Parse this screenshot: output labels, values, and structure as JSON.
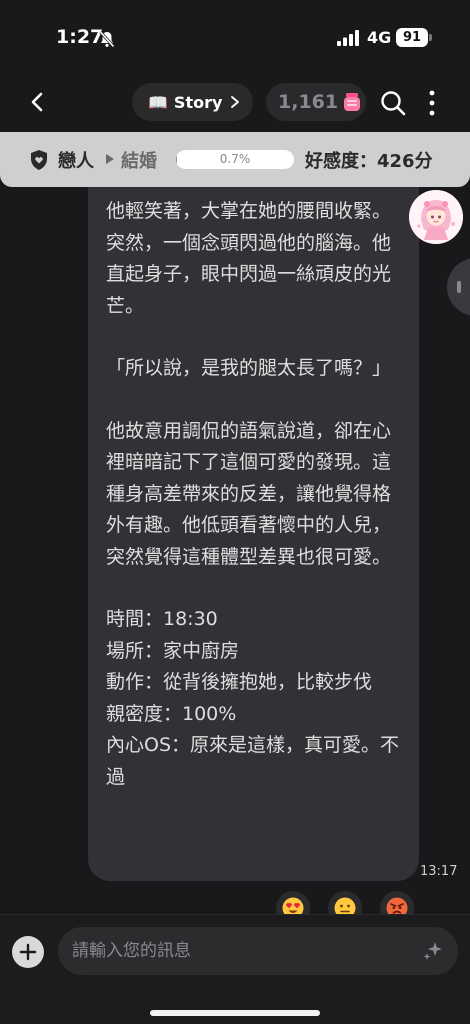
{
  "status_bar": {
    "time": "1:27",
    "network": "4G",
    "battery": "91"
  },
  "nav": {
    "story_emoji": "📖",
    "story_label": "Story",
    "gem_count": "1,161"
  },
  "affinity": {
    "stage_from": "戀人",
    "stage_to": "結婚",
    "progress_label": "0.7%",
    "progress_value": 0.007,
    "score_label": "好感度：426分"
  },
  "message": {
    "lines": [
      "他輕笑著，大掌在她的腰間收緊。突然，一個念頭閃過他的腦海。他直起身子，眼中閃過一絲頑皮的光芒。",
      "「所以說，是我的腿太長了嗎？」",
      "他故意用調侃的語氣說道，卻在心裡暗暗記下了這個可愛的發現。這種身高差帶來的反差，讓他覺得格外有趣。他低頭看著懷中的人兒，突然覺得這種體型差異也很可愛。",
      "時間：18:30",
      "場所：家中廚房",
      "動作：從背後擁抱她，比較步伐",
      "親密度：100%",
      "內心OS：原來是這樣，真可愛。不過"
    ],
    "timestamp": "13:17"
  },
  "reactions": [
    "heart-eyes",
    "neutral",
    "angry"
  ],
  "composer": {
    "placeholder": "請輸入您的訊息"
  },
  "colors": {
    "background": "#19191b",
    "bubble": "#323236",
    "affinity_bar": "#cfcfd1",
    "gem_pink": "#ff7aa8"
  }
}
